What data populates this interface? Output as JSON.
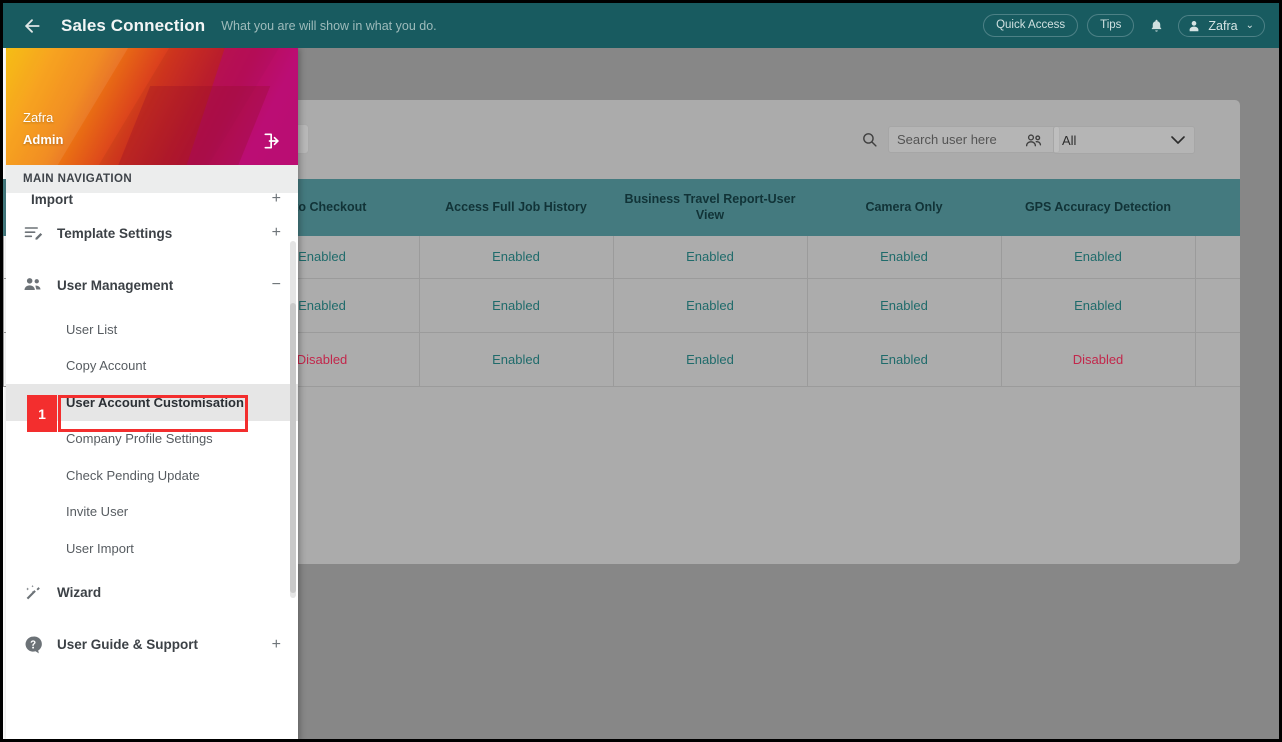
{
  "header": {
    "back_icon": "arrow-left-icon",
    "title": "Sales Connection",
    "tagline": "What you are will show in what you do.",
    "quick_access_label": "Quick Access",
    "tips_label": "Tips",
    "bell_icon": "bell-icon",
    "user_name": "Zafra",
    "caret": "⌄"
  },
  "sidebar": {
    "profile": {
      "name": "Zafra",
      "role": "Admin",
      "logout_icon": "logout-icon"
    },
    "section_title": "MAIN NAVIGATION",
    "clipped_item": {
      "label": "Import",
      "expander": "+",
      "icon": "import-icon"
    },
    "items": [
      {
        "label": "Template Settings",
        "expander": "+",
        "icon": "template-icon"
      },
      {
        "label": "User Management",
        "expander": "−",
        "icon": "users-icon"
      },
      {
        "label": "Wizard",
        "expander": "",
        "icon": "wand-icon"
      },
      {
        "label": "User Guide & Support",
        "expander": "+",
        "icon": "help-icon"
      }
    ],
    "user_management_children": [
      {
        "label": "User List",
        "active": false
      },
      {
        "label": "Copy Account",
        "active": false
      },
      {
        "label": "User Account Customisation",
        "active": true
      },
      {
        "label": "Company Profile Settings",
        "active": false
      },
      {
        "label": "Check Pending Update",
        "active": false
      },
      {
        "label": "Invite User",
        "active": false
      },
      {
        "label": "User Import",
        "active": false
      }
    ],
    "annotation_badge": "1"
  },
  "toolbar": {
    "search_icon": "search-icon",
    "search_placeholder": "Search user here",
    "search_value": "",
    "people_icon": "people-filter-icon",
    "filter_selected": "All",
    "filter_caret": "chevron-down-icon"
  },
  "table": {
    "columns": [
      "Auto Checkout",
      "Access Full Job History",
      "Business Travel Report-User View",
      "Camera Only",
      "GPS Accuracy Detection"
    ],
    "rows": [
      [
        "Enabled",
        "Enabled",
        "Enabled",
        "Enabled",
        "Enabled"
      ],
      [
        "Enabled",
        "Enabled",
        "Enabled",
        "Enabled",
        "Enabled"
      ],
      [
        "Disabled",
        "Enabled",
        "Enabled",
        "Enabled",
        "Disabled"
      ]
    ]
  },
  "scrollbar": {
    "right_arrow": "▶"
  },
  "colors": {
    "topbar": "#185b60",
    "table_header": "#447a7f",
    "enabled": "#1f6b6b",
    "disabled": "#c2274b",
    "annotation": "#f32e2e",
    "overlay": "#878787"
  }
}
